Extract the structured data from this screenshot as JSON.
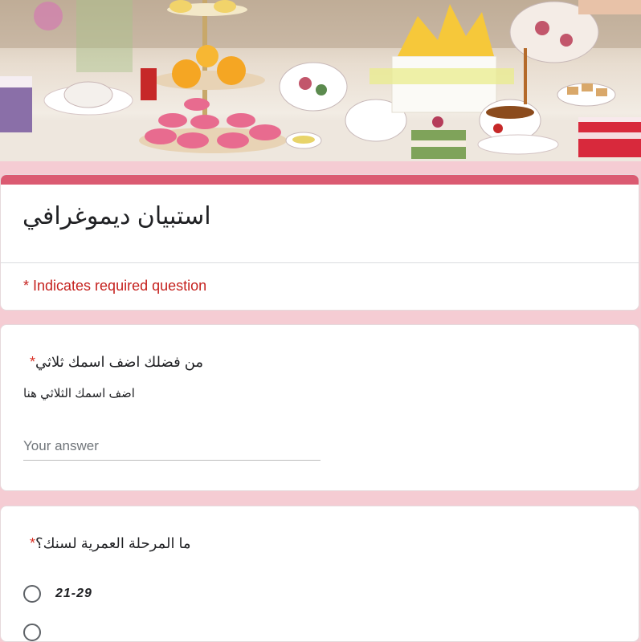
{
  "form": {
    "title": "استبيان ديموغرافي",
    "required_note": "* Indicates required question",
    "accent_color": "#db5b72",
    "background_color": "#f5ccd3"
  },
  "questions": [
    {
      "title": "من فضلك اضف اسمك ثلاثي",
      "required_mark": "*",
      "description": "اضف اسمك الثلاثي هنا",
      "answer_placeholder": "Your answer"
    },
    {
      "title": "ما المرحلة العمرية لسنك؟",
      "required_mark": "*",
      "options": [
        "21-29"
      ]
    }
  ],
  "banner": {
    "image_subject": "afternoon-tea-table"
  }
}
